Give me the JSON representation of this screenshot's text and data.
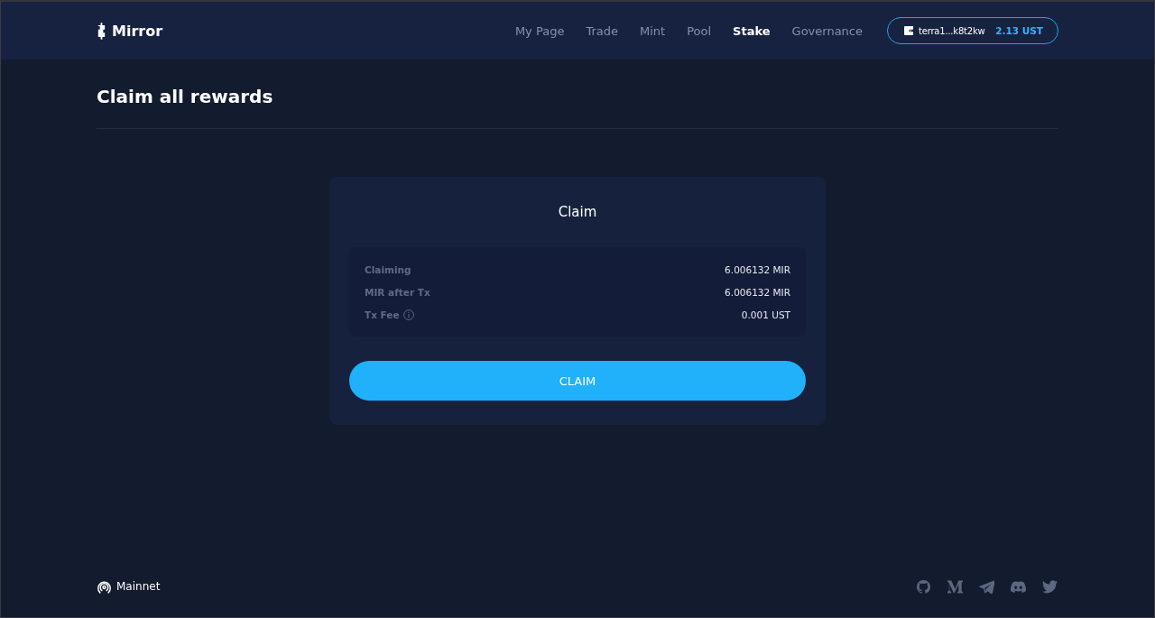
{
  "header": {
    "logo": "Mirror",
    "nav": [
      {
        "label": "My Page",
        "selected": false
      },
      {
        "label": "Trade",
        "selected": false
      },
      {
        "label": "Mint",
        "selected": false
      },
      {
        "label": "Pool",
        "selected": false
      },
      {
        "label": "Stake",
        "selected": true
      },
      {
        "label": "Governance",
        "selected": false
      }
    ],
    "wallet": {
      "address": "terra1...k8t2kw",
      "balance": "2.13 UST"
    }
  },
  "page": {
    "title": "Claim all rewards"
  },
  "claim_card": {
    "title": "Claim",
    "rows": [
      {
        "label": "Claiming",
        "value": "6.006132 MIR",
        "info": false
      },
      {
        "label": "MIR after Tx",
        "value": "6.006132 MIR",
        "info": false
      },
      {
        "label": "Tx Fee",
        "value": "0.001 UST",
        "info": true
      }
    ],
    "button": "CLAIM"
  },
  "footer": {
    "network": "Mainnet"
  }
}
